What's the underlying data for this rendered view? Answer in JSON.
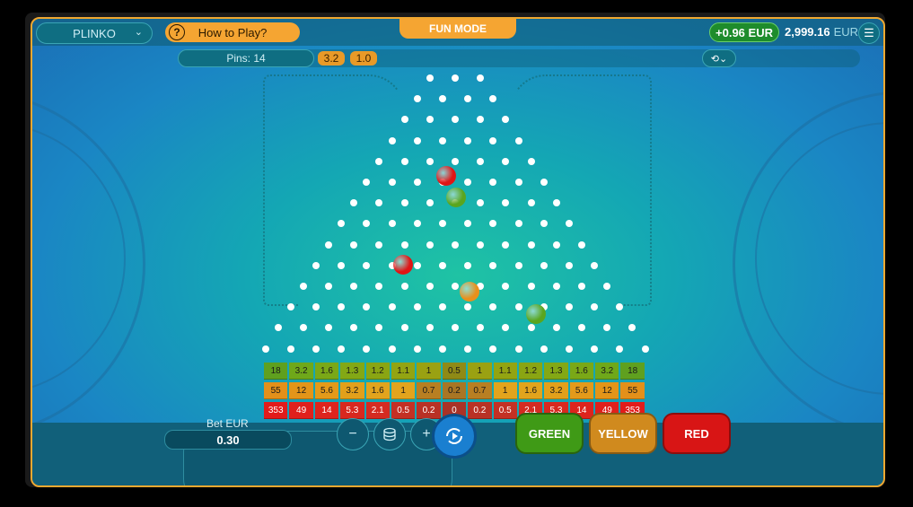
{
  "header": {
    "game_name": "PLINKO",
    "how_to_play": "How to Play?",
    "mode": "FUN MODE",
    "last_win": "+0.96 EUR",
    "balance": "2,999.16",
    "currency": "EUR"
  },
  "settings": {
    "pins_label": "Pins: 14",
    "history": [
      "3.2",
      "1.0"
    ]
  },
  "payouts": {
    "green": [
      "18",
      "3.2",
      "1.6",
      "1.3",
      "1.2",
      "1.1",
      "1",
      "0.5",
      "1",
      "1.1",
      "1.2",
      "1.3",
      "1.6",
      "3.2",
      "18"
    ],
    "yellow": [
      "55",
      "12",
      "5.6",
      "3.2",
      "1.6",
      "1",
      "0.7",
      "0.2",
      "0.7",
      "1",
      "1.6",
      "3.2",
      "5.6",
      "12",
      "55"
    ],
    "red": [
      "353",
      "49",
      "14",
      "5.3",
      "2.1",
      "0.5",
      "0.2",
      "0",
      "0.2",
      "0.5",
      "2.1",
      "5.3",
      "14",
      "49",
      "353"
    ]
  },
  "colors": {
    "green_row": [
      "#5fa01f",
      "#6fa81a",
      "#7aa817",
      "#83a815",
      "#8aa513",
      "#93a412",
      "#9aa112",
      "#8f8a16",
      "#9aa112",
      "#93a412",
      "#8aa513",
      "#83a815",
      "#7aa817",
      "#6fa81a",
      "#5fa01f"
    ],
    "yellow_row": [
      "#e3901a",
      "#e39519",
      "#e39a1a",
      "#e2a01b",
      "#e2a41d",
      "#e2a41d",
      "#b87f22",
      "#a97624",
      "#b87f22",
      "#e2a41d",
      "#e2a41d",
      "#e2a01b",
      "#e39a1a",
      "#e39519",
      "#e3901a"
    ],
    "red_row": [
      "#e21b1b",
      "#e0201c",
      "#dd241d",
      "#d8281f",
      "#d42b21",
      "#c43024",
      "#b93125",
      "#a93226",
      "#b93125",
      "#c43024",
      "#d42b21",
      "#d8281f",
      "#dd241d",
      "#e0201c",
      "#e21b1b"
    ]
  },
  "balls": [
    {
      "color": "#e01515"
    },
    {
      "color": "#5aa51e"
    },
    {
      "color": "#e01515"
    },
    {
      "color": "#e8901c"
    },
    {
      "color": "#5aa51e"
    }
  ],
  "bet": {
    "label": "Bet EUR",
    "value": "0.30",
    "minus": "−",
    "plus": "+"
  },
  "actions": {
    "green": "GREEN",
    "yellow": "YELLOW",
    "red": "RED"
  }
}
